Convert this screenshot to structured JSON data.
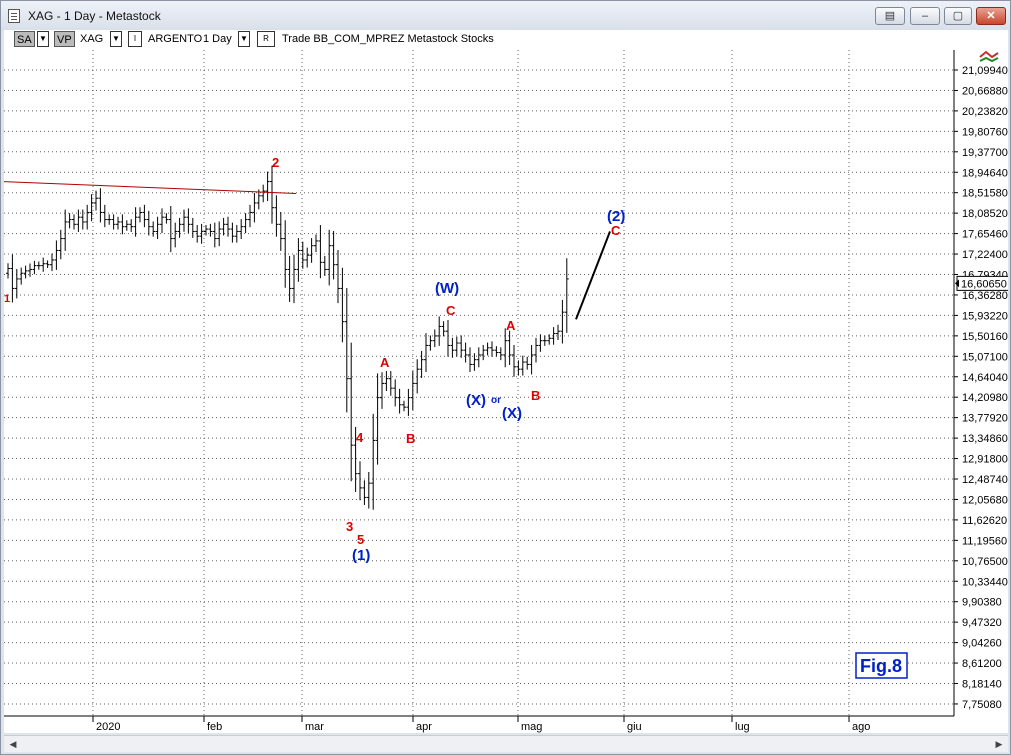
{
  "window": {
    "title": "XAG - 1 Day - Metastock",
    "restore_label": "▤",
    "minimize_label": "–",
    "maximize_label": "▢",
    "close_label": "✕"
  },
  "toolbar": {
    "sa_label": "SA",
    "vp_label": "VP",
    "symbol": "XAG",
    "indicator_label": "I",
    "security_name": "ARGENTO",
    "period": "1 Day",
    "r_label": "R",
    "info_text": "Trade  BB_COM_MPREZ  Metastock  Stocks"
  },
  "scrollbar": {
    "left_arrow": "◀",
    "right_arrow": "▶"
  },
  "colors": {
    "wave_red": "#e00000",
    "wave_blue": "#0020c8",
    "trendline": "#b00000",
    "bars": "#000000",
    "grid": "#606060"
  },
  "chart_data": {
    "type": "ohlc-bar",
    "symbol": "XAG",
    "interval": "1 Day",
    "price_axis": {
      "ticks": [
        "21,09940",
        "20,66880",
        "20,23820",
        "19,80760",
        "19,37700",
        "18,94640",
        "18,51580",
        "18,08520",
        "17,65460",
        "17,22400",
        "16,79340",
        "16,36280",
        "15,93220",
        "15,50160",
        "15,07100",
        "14,64040",
        "14,20980",
        "13,77920",
        "13,34860",
        "12,91800",
        "12,48740",
        "12,05680",
        "11,62620",
        "11,19560",
        "10,76500",
        "10,33440",
        "9,90380",
        "9,47320",
        "9,04260",
        "8,61200",
        "8,18140",
        "7,75080"
      ],
      "range": [
        7.75,
        21.1
      ],
      "current_price_label": "16,60650",
      "current_price": 16.6065
    },
    "time_axis": {
      "months": [
        "2020",
        "feb",
        "mar",
        "apr",
        "mag",
        "giu",
        "lug",
        "ago"
      ]
    },
    "closes": [
      16.92,
      16.5,
      16.7,
      16.82,
      16.87,
      16.9,
      16.98,
      16.98,
      17.02,
      17.0,
      17.1,
      17.3,
      17.55,
      17.9,
      17.95,
      17.85,
      18.0,
      17.9,
      18.1,
      18.3,
      18.4,
      18.1,
      17.95,
      17.95,
      17.85,
      17.9,
      17.8,
      17.85,
      17.8,
      18.0,
      18.1,
      17.95,
      17.8,
      17.7,
      17.85,
      18.0,
      17.95,
      17.55,
      17.7,
      17.85,
      18.0,
      17.85,
      17.7,
      17.6,
      17.7,
      17.75,
      17.7,
      17.55,
      17.75,
      17.85,
      17.75,
      17.6,
      17.7,
      17.8,
      17.95,
      18.1,
      18.3,
      18.45,
      18.55,
      18.75,
      18.2,
      17.85,
      17.55,
      16.9,
      16.5,
      16.9,
      17.3,
      17.1,
      17.2,
      17.4,
      17.5,
      17.05,
      16.9,
      17.4,
      17.0,
      16.5,
      15.8,
      14.6,
      13.2,
      12.6,
      12.3,
      12.1,
      12.4,
      13.3,
      14.2,
      14.5,
      14.6,
      14.4,
      14.2,
      14.05,
      14.0,
      14.2,
      14.5,
      14.8,
      15.0,
      15.3,
      15.4,
      15.5,
      15.7,
      15.6,
      15.3,
      15.2,
      15.35,
      15.2,
      15.1,
      14.9,
      15.0,
      15.1,
      15.2,
      15.25,
      15.2,
      15.15,
      15.1,
      15.4,
      15.1,
      14.85,
      14.8,
      14.95,
      14.9,
      15.1,
      15.3,
      15.4,
      15.4,
      15.45,
      15.55,
      15.6,
      16.0,
      16.7
    ],
    "projection": {
      "from": 15.85,
      "to": 17.7
    },
    "trendline": {
      "from": 18.75,
      "to": 18.5
    },
    "wave_labels": [
      {
        "text": "1",
        "color": "red"
      },
      {
        "text": "2",
        "color": "red"
      },
      {
        "text": "3",
        "color": "red"
      },
      {
        "text": "4",
        "color": "red"
      },
      {
        "text": "5",
        "color": "red"
      },
      {
        "text": "(1)",
        "color": "blue"
      },
      {
        "text": "A",
        "color": "red"
      },
      {
        "text": "B",
        "color": "red"
      },
      {
        "text": "(W)",
        "color": "blue"
      },
      {
        "text": "C",
        "color": "red"
      },
      {
        "text": "(X)",
        "color": "blue"
      },
      {
        "text": "or",
        "color": "blue"
      },
      {
        "text": "(X)",
        "color": "blue"
      },
      {
        "text": "A",
        "color": "red"
      },
      {
        "text": "B",
        "color": "red"
      },
      {
        "text": "(2)",
        "color": "blue"
      },
      {
        "text": "C",
        "color": "red"
      }
    ],
    "annotation": "Fig.8"
  }
}
